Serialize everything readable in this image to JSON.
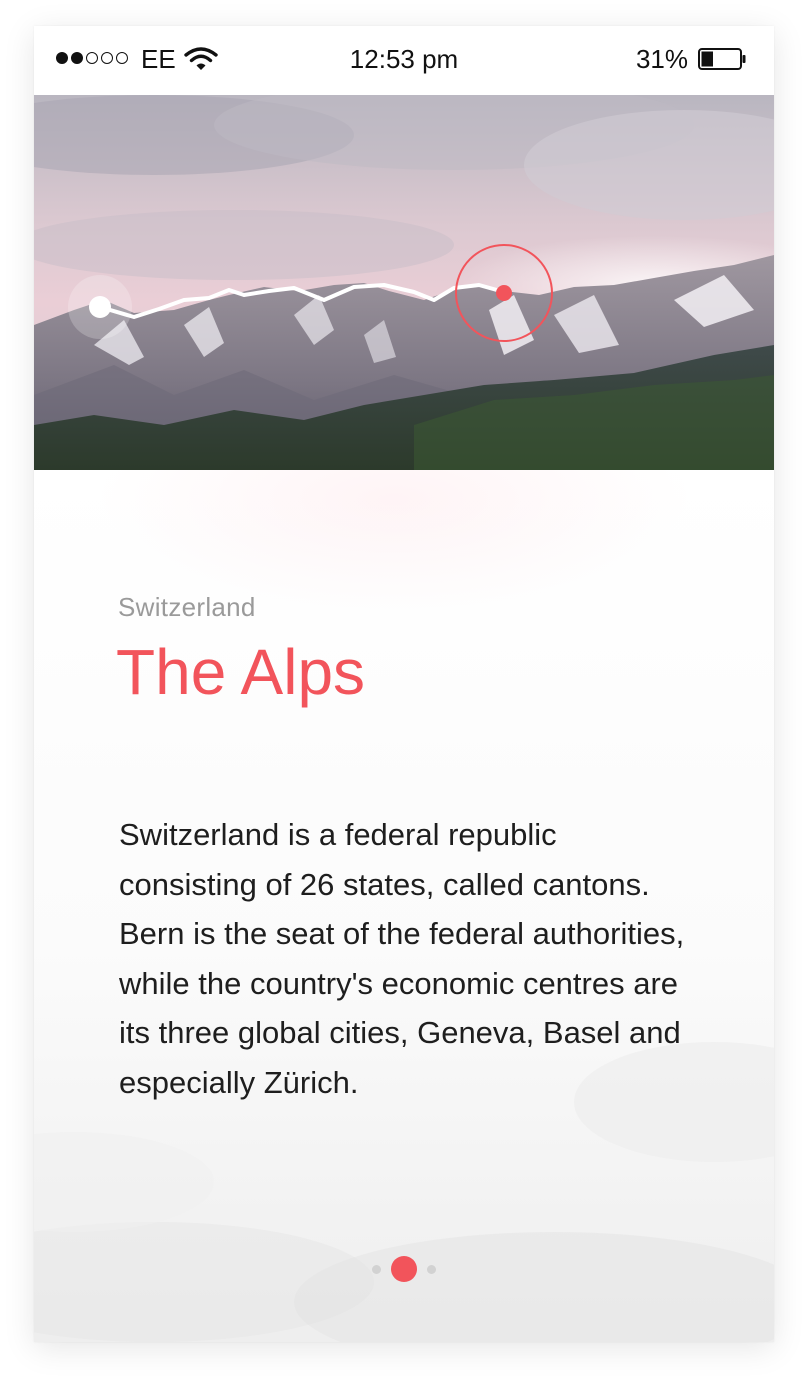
{
  "status_bar": {
    "signal_filled": 2,
    "signal_total": 5,
    "carrier": "EE",
    "time": "12:53 pm",
    "battery_text": "31%",
    "battery_level": 0.31
  },
  "hero": {
    "icons": [
      "mountain-photo",
      "altitude-profile-line",
      "start-marker",
      "location-marker"
    ],
    "accent_color": "#f2545b"
  },
  "place": {
    "country": "Switzerland",
    "name": "The Alps",
    "description": "Switzerland is a federal republic consisting of 26 states, called cantons. Bern is the seat of the federal authorities, while the country's economic centres are its three global cities, Geneva, Basel and especially Zürich."
  },
  "pagination": {
    "total": 3,
    "active": 2
  }
}
